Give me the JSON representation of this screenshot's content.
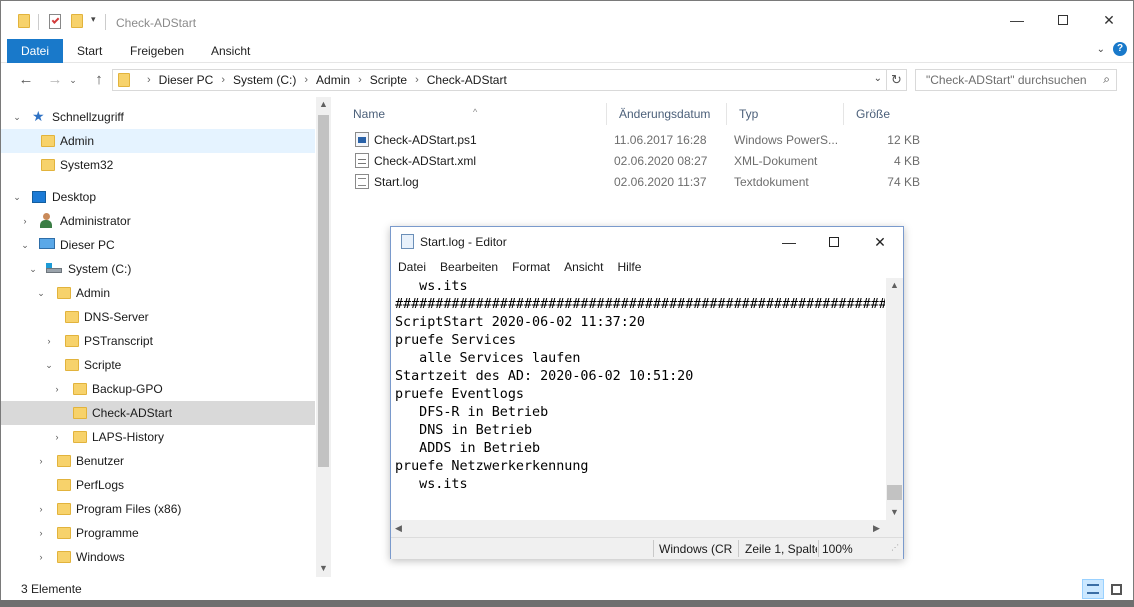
{
  "window": {
    "title": "Check-ADStart"
  },
  "ribbon": {
    "tabs": [
      "Datei",
      "Start",
      "Freigeben",
      "Ansicht"
    ]
  },
  "address": {
    "crumbs": [
      "Dieser PC",
      "System (C:)",
      "Admin",
      "Scripte",
      "Check-ADStart"
    ],
    "search_placeholder": "\"Check-ADStart\" durchsuchen"
  },
  "nav": {
    "items": [
      {
        "label": "Schnellzugriff",
        "icon": "star-icon"
      },
      {
        "label": "Admin",
        "icon": "folder-icon"
      },
      {
        "label": "System32",
        "icon": "folder-icon"
      },
      {
        "label": "Desktop",
        "icon": "desktop-icon"
      },
      {
        "label": "Administrator",
        "icon": "user-icon"
      },
      {
        "label": "Dieser PC",
        "icon": "computer-icon"
      },
      {
        "label": "System (C:)",
        "icon": "drive-icon"
      },
      {
        "label": "Admin",
        "icon": "folder-icon"
      },
      {
        "label": "DNS-Server",
        "icon": "folder-icon"
      },
      {
        "label": "PSTranscript",
        "icon": "folder-icon"
      },
      {
        "label": "Scripte",
        "icon": "folder-icon"
      },
      {
        "label": "Backup-GPO",
        "icon": "folder-icon"
      },
      {
        "label": "Check-ADStart",
        "icon": "folder-icon"
      },
      {
        "label": "LAPS-History",
        "icon": "folder-icon"
      },
      {
        "label": "Benutzer",
        "icon": "folder-icon"
      },
      {
        "label": "PerfLogs",
        "icon": "folder-icon"
      },
      {
        "label": "Program Files (x86)",
        "icon": "folder-icon"
      },
      {
        "label": "Programme",
        "icon": "folder-icon"
      },
      {
        "label": "Windows",
        "icon": "folder-icon"
      }
    ]
  },
  "files": {
    "columns": [
      "Name",
      "Änderungsdatum",
      "Typ",
      "Größe"
    ],
    "rows": [
      {
        "name": "Check-ADStart.ps1",
        "date": "11.06.2017 16:28",
        "type": "Windows PowerS...",
        "size": "12 KB",
        "icon": "powershell-file-icon"
      },
      {
        "name": "Check-ADStart.xml",
        "date": "02.06.2020 08:27",
        "type": "XML-Dokument",
        "size": "4 KB",
        "icon": "xml-file-icon"
      },
      {
        "name": "Start.log",
        "date": "02.06.2020 11:37",
        "type": "Textdokument",
        "size": "74 KB",
        "icon": "text-file-icon"
      }
    ]
  },
  "status": {
    "count": "3 Elemente"
  },
  "notepad": {
    "title": "Start.log - Editor",
    "menu": [
      "Datei",
      "Bearbeiten",
      "Format",
      "Ansicht",
      "Hilfe"
    ],
    "lines": [
      "   ws.its",
      "##############################################################",
      "ScriptStart 2020-06-02 11:37:20",
      "pruefe Services",
      "   alle Services laufen",
      "Startzeit des AD: 2020-06-02 10:51:20",
      "pruefe Eventlogs",
      "   DFS-R in Betrieb",
      "   DNS in Betrieb",
      "   ADDS in Betrieb",
      "pruefe Netzwerkerkennung",
      "   ws.its"
    ],
    "status": {
      "encoding": "Windows (CR",
      "position": "Zeile 1, Spalte",
      "zoom": "100%"
    }
  }
}
